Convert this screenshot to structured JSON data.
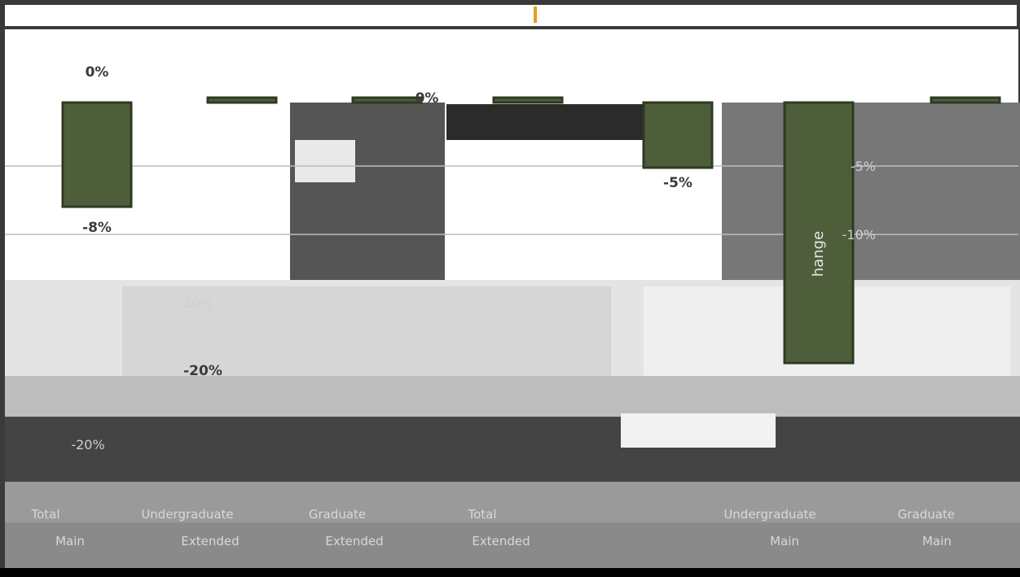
{
  "chart_data": {
    "type": "bar",
    "title": "",
    "xlabel": "",
    "ylabel": "hange",
    "ylim": [
      -22,
      2
    ],
    "yticks": [
      "-5%",
      "-10%",
      "-20%",
      "-20%"
    ],
    "categories": [
      {
        "top": "Total",
        "bottom": "Main"
      },
      {
        "top": "Undergraduate",
        "bottom": "Extended"
      },
      {
        "top": "Graduate",
        "bottom": "Extended"
      },
      {
        "top": "Total",
        "bottom": "Extended"
      },
      {
        "top": "",
        "bottom": ""
      },
      {
        "top": "Undergraduate",
        "bottom": "Main"
      },
      {
        "top": "Graduate",
        "bottom": "Main"
      }
    ],
    "values": [
      -8,
      0,
      0,
      0,
      -5,
      -20,
      0
    ],
    "data_labels": [
      "0%",
      "-8%",
      "0%",
      "-5%",
      "-20%"
    ],
    "colors": {
      "bar": "#4e5e3a",
      "bar_edge": "#2e3a22",
      "background": "#3a3a3a",
      "panel": "#ffffff"
    }
  }
}
